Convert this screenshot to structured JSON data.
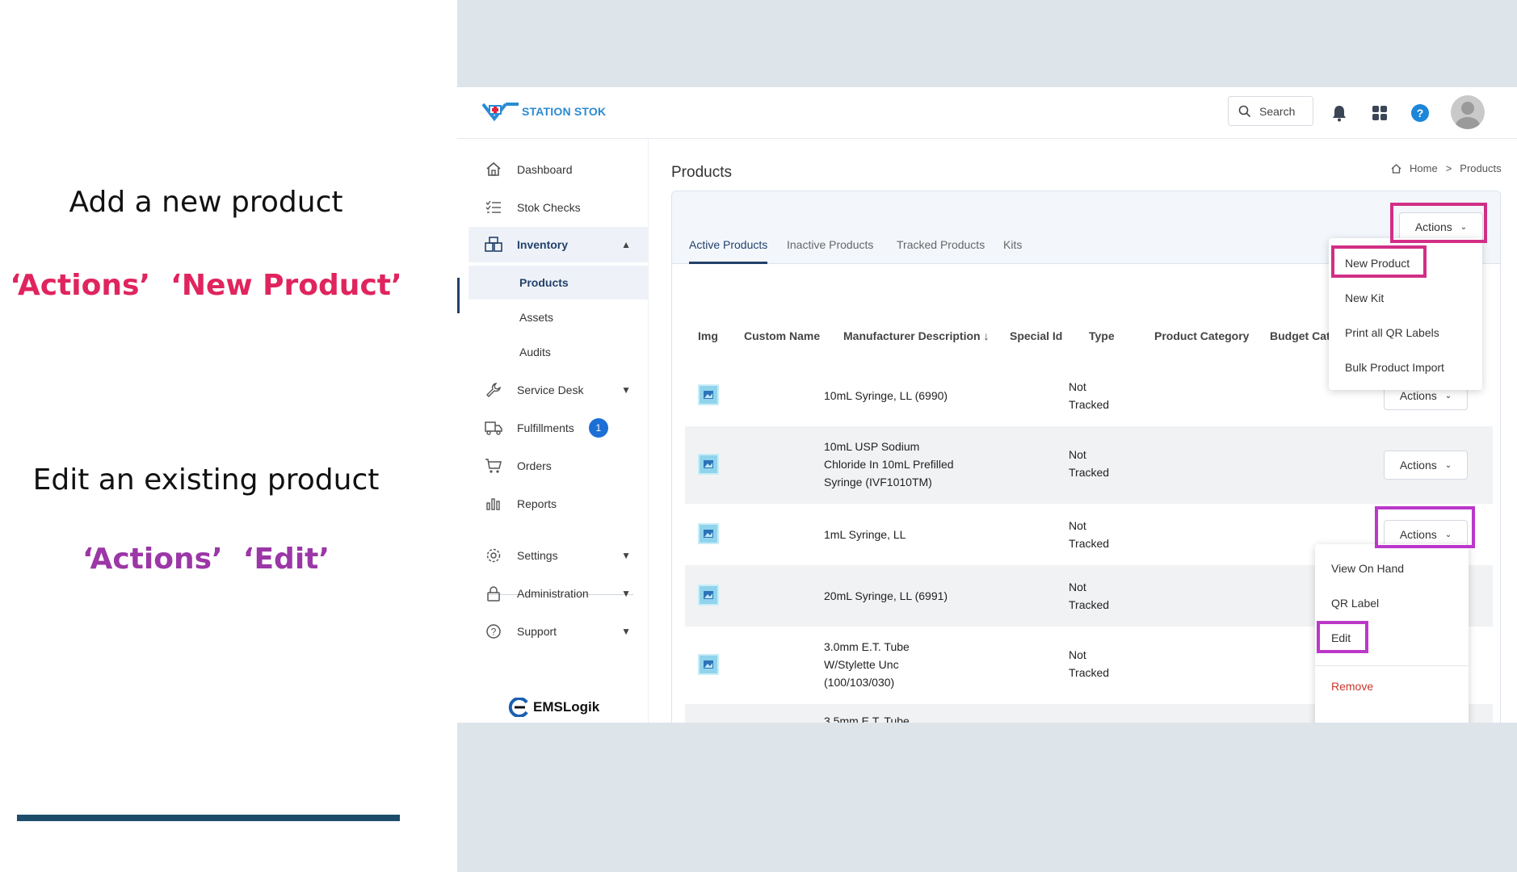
{
  "instructions": {
    "add_heading": "Add a new product",
    "add_step_1": "‘Actions’",
    "add_step_2": "‘New Product’",
    "edit_heading": "Edit an existing product",
    "edit_step_1": "‘Actions’",
    "edit_step_2": "‘Edit’"
  },
  "colors": {
    "highlight_pink": "#d12f86",
    "highlight_purple": "#bb38c9",
    "nav_active": "#23416a",
    "badge": "#1c6fd4"
  },
  "header": {
    "logo_text": "STATION STOK",
    "search_label": "Search"
  },
  "sidebar": {
    "items": [
      {
        "label": "Dashboard",
        "icon": "home-icon"
      },
      {
        "label": "Stok Checks",
        "icon": "checklist-icon"
      },
      {
        "label": "Inventory",
        "icon": "inventory-icon"
      },
      {
        "label": "Service Desk",
        "icon": "wrench-icon"
      },
      {
        "label": "Fulfillments",
        "icon": "truck-icon",
        "badge": "1"
      },
      {
        "label": "Orders",
        "icon": "cart-icon"
      },
      {
        "label": "Reports",
        "icon": "bar-chart-icon"
      },
      {
        "label": "Settings",
        "icon": "gear-icon"
      },
      {
        "label": "Administration",
        "icon": "lock-icon"
      },
      {
        "label": "Support",
        "icon": "help-circle-icon"
      }
    ],
    "inventory_sub": [
      "Products",
      "Assets",
      "Audits"
    ],
    "footer_logo": "EMSLogik"
  },
  "main": {
    "title": "Products",
    "breadcrumb": {
      "home": "Home",
      "sep": ">",
      "current": "Products"
    },
    "actions_label": "Actions",
    "tabs": [
      "Active Products",
      "Inactive Products",
      "Tracked Products",
      "Kits"
    ],
    "columns": [
      "Img",
      "Custom Name",
      "Manufacturer Description ↓",
      "Special Id",
      "Type",
      "Product Category",
      "Budget Cat"
    ],
    "rows": [
      {
        "desc": [
          "10mL Syringe, LL (6990)"
        ],
        "type": [
          "Not",
          "Tracked"
        ]
      },
      {
        "desc": [
          "10mL USP Sodium",
          "Chloride In 10mL Prefilled",
          "Syringe (IVF1010TM)"
        ],
        "type": [
          "Not",
          "Tracked"
        ]
      },
      {
        "desc": [
          "1mL Syringe, LL"
        ],
        "type": [
          "Not",
          "Tracked"
        ]
      },
      {
        "desc": [
          "20mL Syringe, LL (6991)"
        ],
        "type": [
          "Not",
          "Tracked"
        ]
      },
      {
        "desc": [
          "3.0mm E.T. Tube",
          "W/Stylette Unc",
          "(100/103/030)"
        ],
        "type": [
          "Not",
          "Tracked"
        ]
      },
      {
        "desc": [
          "3.5mm E.T. Tube"
        ],
        "type": []
      }
    ],
    "top_actions_menu": [
      "New Product",
      "New Kit",
      "Print all QR Labels",
      "Bulk Product Import"
    ],
    "row_actions_menu": [
      "View On Hand",
      "QR Label",
      "Edit",
      "Remove"
    ]
  }
}
